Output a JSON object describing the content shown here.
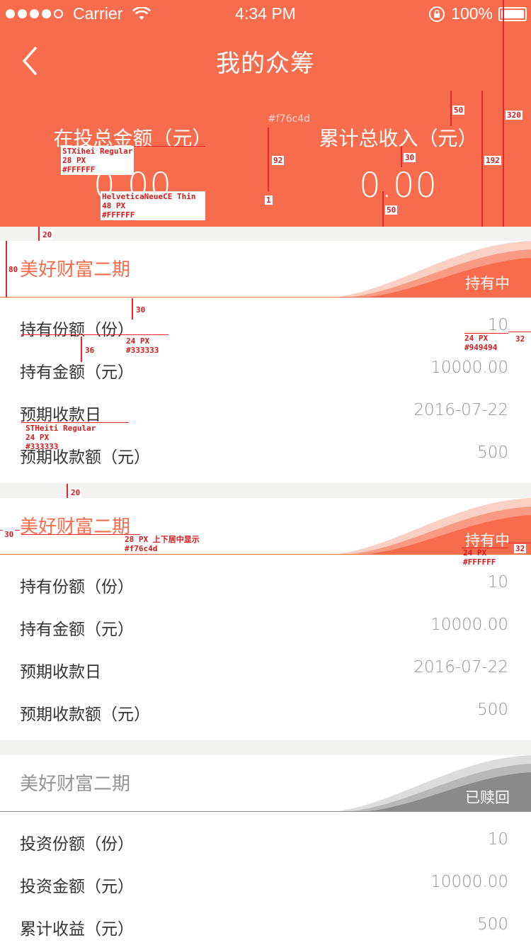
{
  "status_bar": {
    "carrier": "Carrier",
    "time": "4:34 PM",
    "battery": "100%"
  },
  "nav": {
    "title": "我的众筹"
  },
  "stats": {
    "holding_label": "在投总金额（元）",
    "holding_value": "0.00",
    "income_label": "累计总收入（元）",
    "income_value": "0.00"
  },
  "colors": {
    "accent": "#f76c4d",
    "text": "#333333",
    "muted": "#949494",
    "grey_badge": "#8a8a8a"
  },
  "annotations": {
    "hex": "#f76c4d",
    "font_label": [
      "STXihei Regular",
      "28 PX",
      "#FFFFFF"
    ],
    "font_value": [
      "HelveticaNeueCE Thin",
      "48 PX",
      "#FFFFFF"
    ],
    "row_text": [
      "24 PX",
      "#333333"
    ],
    "row_value": [
      "24 PX",
      "#949494"
    ],
    "row_font": [
      "STHeiti Regular",
      "24 PX",
      "#333333"
    ],
    "title_font": [
      "28 PX 上下居中显示",
      "#f76c4d"
    ],
    "badge_font": [
      "24 PX",
      "#FFFFFF"
    ],
    "numbers": {
      "n20": "20",
      "n30": "30",
      "n36": "36",
      "n32": "32",
      "n50": "50",
      "n80": "80",
      "n92": "92",
      "n1": "1",
      "n192": "192",
      "n320": "320"
    }
  },
  "cards": [
    {
      "title": "美好财富二期",
      "badge": "持有中",
      "rows": [
        {
          "label": "持有份额（份）",
          "value": "10"
        },
        {
          "label": "持有金额（元）",
          "value": "10000.00"
        },
        {
          "label": "预期收款日",
          "value": "2016-07-22"
        },
        {
          "label": "预期收款额（元）",
          "value": "500"
        }
      ]
    },
    {
      "title": "美好财富二期",
      "badge": "持有中",
      "rows": [
        {
          "label": "持有份额（份）",
          "value": "10"
        },
        {
          "label": "持有金额（元）",
          "value": "10000.00"
        },
        {
          "label": "预期收款日",
          "value": "2016-07-22"
        },
        {
          "label": "预期收款额（元）",
          "value": "500"
        }
      ]
    },
    {
      "title": "美好财富二期",
      "badge": "已赎回",
      "rows": [
        {
          "label": "投资份额（份）",
          "value": "10"
        },
        {
          "label": "投资金额（元）",
          "value": "10000.00"
        },
        {
          "label": "累计收益（元）",
          "value": "500"
        }
      ]
    }
  ]
}
